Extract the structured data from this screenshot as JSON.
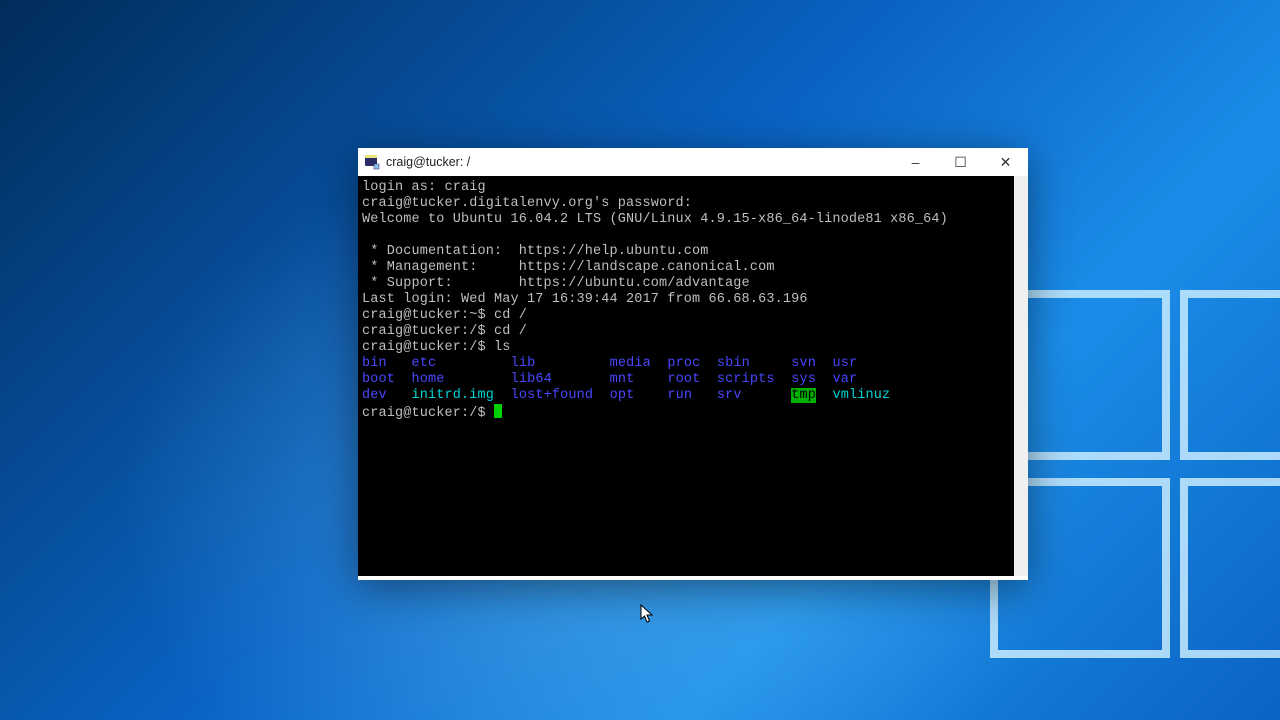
{
  "window": {
    "title": "craig@tucker: /",
    "buttons": {
      "minimize": "–",
      "maximize": "☐",
      "close": "✕"
    }
  },
  "term": {
    "login_as_label": "login as: ",
    "login_user": "craig",
    "pwd_line": "craig@tucker.digitalenvy.org's password:",
    "welcome": "Welcome to Ubuntu 16.04.2 LTS (GNU/Linux 4.9.15-x86_64-linode81 x86_64)",
    "links": {
      "doc": " * Documentation:  https://help.ubuntu.com",
      "mgmt": " * Management:     https://landscape.canonical.com",
      "support": " * Support:        https://ubuntu.com/advantage"
    },
    "last_login": "Last login: Wed May 17 16:39:44 2017 from 66.68.63.196",
    "p1": {
      "prompt": "craig@tucker:~$ ",
      "cmd": "cd /"
    },
    "p2": {
      "prompt": "craig@tucker:/$ ",
      "cmd": "cd /"
    },
    "p3": {
      "prompt": "craig@tucker:/$ ",
      "cmd": "ls"
    },
    "p4": {
      "prompt": "craig@tucker:/$ "
    },
    "ls": {
      "row1": {
        "c1": "bin",
        "c2": "etc",
        "c3": "lib",
        "c4": "media",
        "c5": "proc",
        "c6": "sbin",
        "c7": "svn",
        "c8": "usr"
      },
      "row2": {
        "c1": "boot",
        "c2": "home",
        "c3": "lib64",
        "c4": "mnt",
        "c5": "root",
        "c6": "scripts",
        "c7": "sys",
        "c8": "var"
      },
      "row3": {
        "c1": "dev",
        "c2": "initrd.img",
        "c3": "lost+found",
        "c4": "opt",
        "c5": "run",
        "c6": "srv",
        "c7": "tmp",
        "c8": "vmlinuz"
      },
      "pad": {
        "c1": "   ",
        "c1b": "  ",
        "c1c": "   ",
        "c2": "         ",
        "c2b": "        ",
        "c2c": "  ",
        "c3": "         ",
        "c3b": "       ",
        "c3c": "  ",
        "c4": "  ",
        "c4b": "    ",
        "c4c": "    ",
        "c5": "  ",
        "c5b": "  ",
        "c5c": "   ",
        "c6": "     ",
        "c6b": "  ",
        "c6c": "      ",
        "c7": "  ",
        "c7b": "  ",
        "c7c": "  "
      }
    }
  }
}
